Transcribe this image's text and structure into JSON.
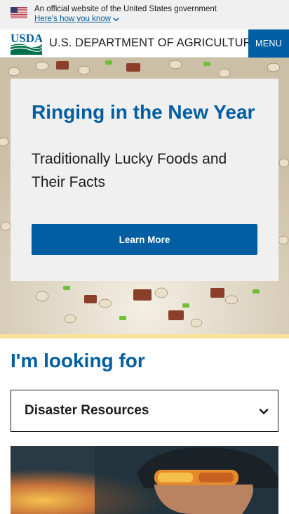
{
  "gov_banner": {
    "official_text": "An official website of the United States government",
    "how_you_know": "Here's how you know"
  },
  "header": {
    "logo_text": "USDA",
    "department": "U.S. DEPARTMENT OF AGRICULTURE",
    "menu_label": "MENU"
  },
  "hero": {
    "title": "Ringing in the New Year",
    "subtitle": "Traditionally Lucky Foods and Their Facts",
    "button_label": "Learn More"
  },
  "looking_for": {
    "title": "I'm looking for",
    "selected": "Disaster Resources"
  },
  "colors": {
    "primary": "#005ea2",
    "accent_gold": "#fbe29a",
    "card_bg": "#f0f0f0"
  },
  "icons": {
    "flag": "us-flag-icon",
    "chevron": "chevron-down-icon",
    "logo": "usda-logo-icon"
  }
}
